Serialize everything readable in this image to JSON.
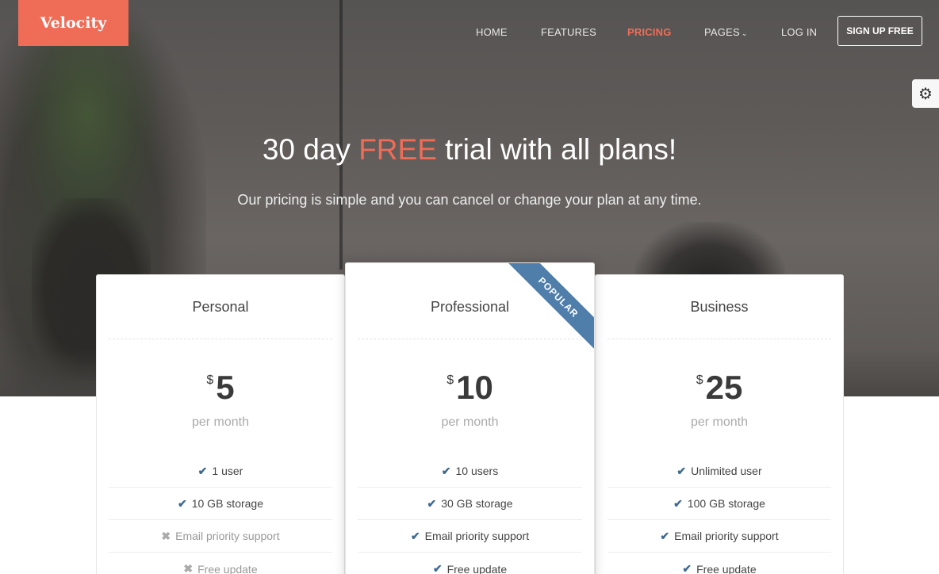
{
  "brand": {
    "name": "Velocity",
    "accent": "#ef6c57",
    "ribbon_color": "#4f7eaa"
  },
  "nav": {
    "items": [
      {
        "label": "HOME"
      },
      {
        "label": "FEATURES"
      },
      {
        "label": "PRICING",
        "active": true
      },
      {
        "label": "PAGES",
        "has_dropdown": true
      },
      {
        "label": "LOG IN"
      }
    ],
    "signup_label": "SIGN UP FREE",
    "settings_icon": "gear-icon"
  },
  "hero": {
    "title_before": "30 day ",
    "title_accent": "FREE",
    "title_after": " trial with all plans!",
    "subtitle": "Our pricing is simple and you can cancel or change your plan at any time."
  },
  "plans": [
    {
      "name": "Personal",
      "currency": "$",
      "price": "5",
      "period": "per month",
      "features": [
        {
          "text": "1 user",
          "included": true
        },
        {
          "text": "10 GB storage",
          "included": true
        },
        {
          "text": "Email priority support",
          "included": false
        },
        {
          "text": "Free update",
          "included": false
        }
      ]
    },
    {
      "name": "Professional",
      "currency": "$",
      "price": "10",
      "period": "per month",
      "badge": "POPULAR",
      "features": [
        {
          "text": "10 users",
          "included": true
        },
        {
          "text": "30 GB storage",
          "included": true
        },
        {
          "text": "Email priority support",
          "included": true
        },
        {
          "text": "Free update",
          "included": true
        }
      ]
    },
    {
      "name": "Business",
      "currency": "$",
      "price": "25",
      "period": "per month",
      "features": [
        {
          "text": "Unlimited user",
          "included": true
        },
        {
          "text": "100 GB storage",
          "included": true
        },
        {
          "text": "Email priority support",
          "included": true
        },
        {
          "text": "Free update",
          "included": true
        }
      ]
    }
  ]
}
